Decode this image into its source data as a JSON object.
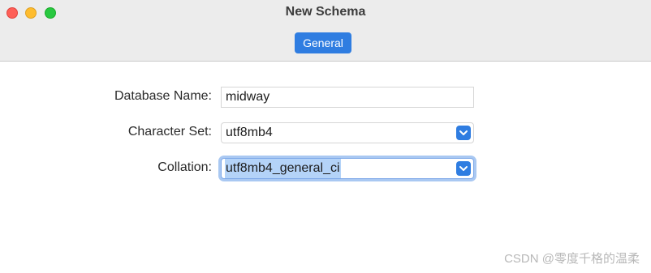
{
  "window": {
    "title": "New Schema"
  },
  "tabs": [
    {
      "label": "General"
    }
  ],
  "form": {
    "database_name_label": "Database Name:",
    "database_name_value": "midway",
    "character_set_label": "Character Set:",
    "character_set_value": "utf8mb4",
    "collation_label": "Collation:",
    "collation_value": "utf8mb4_general_ci"
  },
  "watermark": "CSDN @零度千格的温柔",
  "colors": {
    "accent": "#2f7de1",
    "close": "#fe5f57",
    "minimize": "#febc2e",
    "zoom": "#28c840"
  }
}
